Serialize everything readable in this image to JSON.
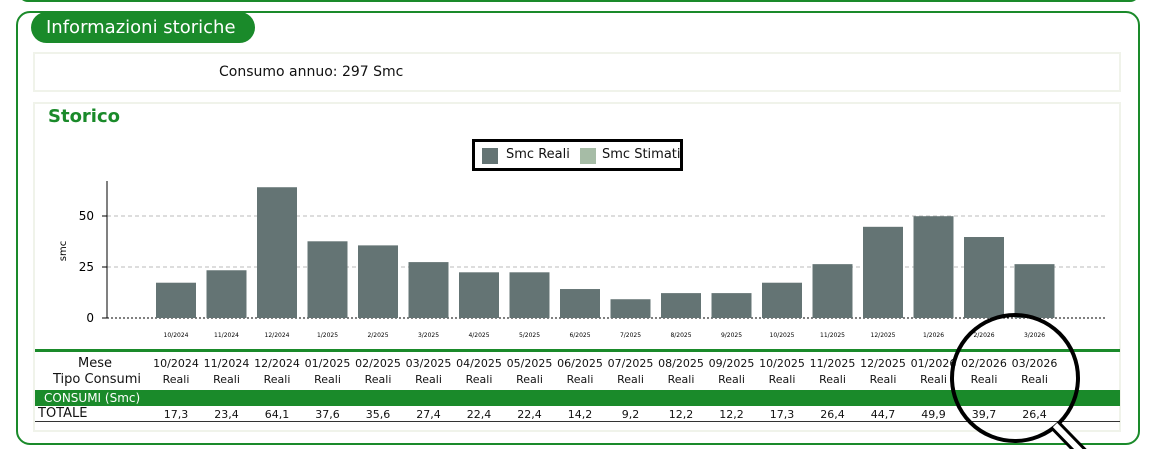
{
  "panel": {
    "title": "Informazioni storiche"
  },
  "annual": {
    "text": "Consumo annuo: 297 Smc"
  },
  "storico": {
    "title": "Storico"
  },
  "legend": {
    "items": [
      {
        "label": "Smc Reali",
        "color": "#647474"
      },
      {
        "label": "Smc Stimati",
        "color": "#a6bca6"
      }
    ]
  },
  "chart_data": {
    "type": "bar",
    "categories": [
      "10/2024",
      "11/2024",
      "12/2024",
      "1/2025",
      "2/2025",
      "3/2025",
      "4/2025",
      "5/2025",
      "6/2025",
      "7/2025",
      "8/2025",
      "9/2025",
      "10/2025",
      "11/2025",
      "12/2025",
      "1/2026",
      "2/2026",
      "3/2026"
    ],
    "series": [
      {
        "name": "Smc Reali",
        "values": [
          17.3,
          23.4,
          64.1,
          37.6,
          35.6,
          27.4,
          22.4,
          22.4,
          14.2,
          9.2,
          12.2,
          12.2,
          17.3,
          26.4,
          44.7,
          49.9,
          39.7,
          26.4
        ]
      }
    ],
    "ylabel": "smc",
    "yticks": [
      0,
      25,
      50
    ],
    "ylim": [
      0,
      68
    ],
    "grid": true,
    "legend_position": "top-center"
  },
  "table": {
    "row_labels": {
      "mese": "Mese",
      "tipo": "Tipo Consumi",
      "consumi": "CONSUMI (Smc)",
      "totale": "TOTALE"
    },
    "months": [
      "10/2024",
      "11/2024",
      "12/2024",
      "01/2025",
      "02/2025",
      "03/2025",
      "04/2025",
      "05/2025",
      "06/2025",
      "07/2025",
      "08/2025",
      "09/2025",
      "10/2025",
      "11/2025",
      "12/2025",
      "01/2026",
      "02/2026",
      "03/2026"
    ],
    "tipo": [
      "Reali",
      "Reali",
      "Reali",
      "Reali",
      "Reali",
      "Reali",
      "Reali",
      "Reali",
      "Reali",
      "Reali",
      "Reali",
      "Reali",
      "Reali",
      "Reali",
      "Reali",
      "Reali",
      "Reali",
      "Reali"
    ],
    "totale": [
      "17,3",
      "23,4",
      "64,1",
      "37,6",
      "35,6",
      "27,4",
      "22,4",
      "22,4",
      "14,2",
      "9,2",
      "12,2",
      "12,2",
      "17,3",
      "26,4",
      "44,7",
      "49,9",
      "39,7",
      "26,4"
    ]
  },
  "colors": {
    "accent": "#1a8a2a",
    "bar": "#647474",
    "estimated": "#a6bca6"
  }
}
